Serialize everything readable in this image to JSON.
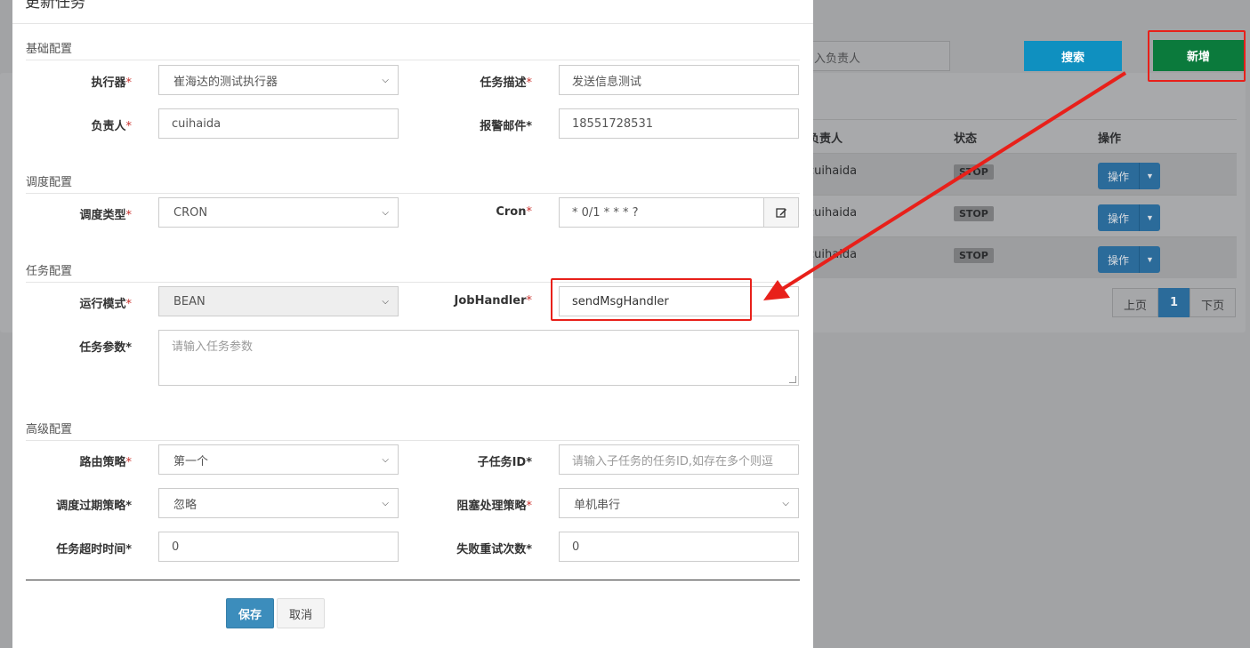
{
  "background": {
    "search_placeholder": "入负责人",
    "search_button": "搜索",
    "add_button": "新增",
    "table": {
      "columns": [
        "负责人",
        "状态",
        "操作"
      ],
      "rows": [
        {
          "owner": "cuihaida",
          "status": "STOP",
          "op": "操作"
        },
        {
          "owner": "cuihaida",
          "status": "STOP",
          "op": "操作"
        },
        {
          "owner": "cuihaida",
          "status": "STOP",
          "op": "操作"
        }
      ]
    },
    "pager": {
      "prev": "上页",
      "current": "1",
      "next": "下页"
    }
  },
  "modal": {
    "title": "更新任务",
    "sections": {
      "basic": "基础配置",
      "schedule": "调度配置",
      "task": "任务配置",
      "advanced": "高级配置"
    },
    "fields": {
      "executor": {
        "label": "执行器",
        "value": "崔海达的测试执行器"
      },
      "desc": {
        "label": "任务描述",
        "value": "发送信息测试"
      },
      "owner": {
        "label": "负责人",
        "value": "cuihaida"
      },
      "alarm_email": {
        "label": "报警邮件*",
        "value": "18551728531"
      },
      "schedule_type": {
        "label": "调度类型",
        "value": "CRON"
      },
      "cron": {
        "label": "Cron",
        "value": "* 0/1 * * * ?"
      },
      "run_mode": {
        "label": "运行模式",
        "value": "BEAN"
      },
      "job_handler": {
        "label": "JobHandler",
        "value": "sendMsgHandler"
      },
      "params": {
        "label": "任务参数*",
        "placeholder": "请输入任务参数"
      },
      "route": {
        "label": "路由策略",
        "value": "第一个"
      },
      "child_id": {
        "label": "子任务ID*",
        "placeholder": "请输入子任务的任务ID,如存在多个则逗"
      },
      "misfire": {
        "label": "调度过期策略*",
        "value": "忽略"
      },
      "block": {
        "label": "阻塞处理策略",
        "value": "单机串行"
      },
      "timeout": {
        "label": "任务超时时间*",
        "value": "0"
      },
      "retry": {
        "label": "失败重试次数*",
        "value": "0"
      }
    },
    "save": "保存",
    "cancel": "取消"
  },
  "colors": {
    "annotation_red": "#e8201a",
    "primary": "#3c8dbc",
    "add_green": "#0b7a3c"
  }
}
